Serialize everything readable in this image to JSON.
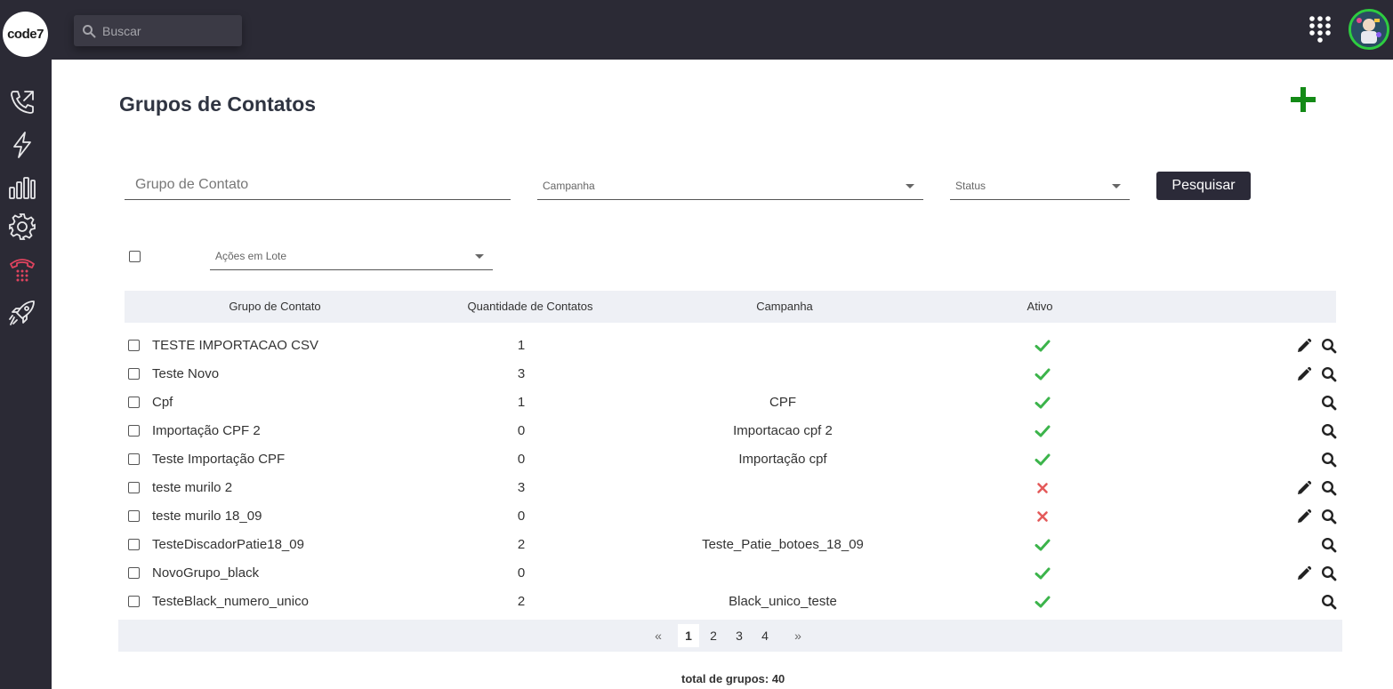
{
  "sidebar": {
    "logo": "code7",
    "items": [
      {
        "icon": "phone-call-icon"
      },
      {
        "icon": "lightning-icon"
      },
      {
        "icon": "bar-chart-icon"
      },
      {
        "icon": "gear-icon"
      },
      {
        "icon": "dialer-phone-icon",
        "color": "#e0445f"
      },
      {
        "icon": "rocket-icon"
      }
    ]
  },
  "topbar": {
    "search_placeholder": "Buscar"
  },
  "page": {
    "title": "Grupos de Contatos"
  },
  "filters": {
    "grupo_placeholder": "Grupo de Contato",
    "campanha_label": "Campanha",
    "status_label": "Status",
    "search_button": "Pesquisar",
    "bulk_label": "Ações em Lote"
  },
  "table": {
    "headers": [
      "Grupo de Contato",
      "Quantidade de Contatos",
      "Campanha",
      "Ativo"
    ],
    "rows": [
      {
        "name": "TESTE IMPORTACAO CSV",
        "qty": "1",
        "campaign": "",
        "active": true,
        "editable": true
      },
      {
        "name": "Teste Novo",
        "qty": "3",
        "campaign": "",
        "active": true,
        "editable": true
      },
      {
        "name": "Cpf",
        "qty": "1",
        "campaign": "CPF",
        "active": true,
        "editable": false
      },
      {
        "name": "Importação CPF 2",
        "qty": "0",
        "campaign": "Importacao cpf 2",
        "active": true,
        "editable": false
      },
      {
        "name": "Teste Importação CPF",
        "qty": "0",
        "campaign": "Importação cpf",
        "active": true,
        "editable": false
      },
      {
        "name": "teste murilo 2",
        "qty": "3",
        "campaign": "",
        "active": false,
        "editable": true
      },
      {
        "name": "teste murilo 18_09",
        "qty": "0",
        "campaign": "",
        "active": false,
        "editable": true
      },
      {
        "name": "TesteDiscadorPatie18_09",
        "qty": "2",
        "campaign": "Teste_Patie_botoes_18_09",
        "active": true,
        "editable": false
      },
      {
        "name": "NovoGrupo_black",
        "qty": "0",
        "campaign": "",
        "active": true,
        "editable": true
      },
      {
        "name": "TesteBlack_numero_unico",
        "qty": "2",
        "campaign": "Black_unico_teste",
        "active": true,
        "editable": false
      }
    ]
  },
  "pagination": {
    "prev": "«",
    "pages": [
      "1",
      "2",
      "3",
      "4"
    ],
    "current": "1",
    "next": "»"
  },
  "footer": {
    "total": "total de grupos: 40"
  },
  "colors": {
    "dark": "#2b2a35",
    "accent_green": "#138a16",
    "check_green": "#3cb44b",
    "cross_red": "#e45a5a"
  }
}
